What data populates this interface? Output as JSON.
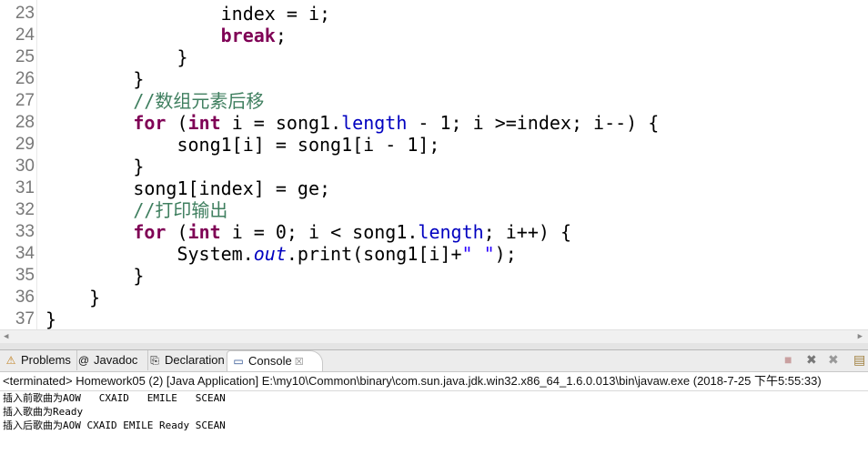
{
  "editor": {
    "lines": [
      {
        "n": "23",
        "indent": 16,
        "parts": [
          [
            "index = i;",
            ""
          ]
        ]
      },
      {
        "n": "24",
        "indent": 16,
        "parts": [
          [
            "break",
            "kw"
          ],
          [
            ";",
            ""
          ]
        ]
      },
      {
        "n": "25",
        "indent": 12,
        "parts": [
          [
            "}",
            ""
          ]
        ]
      },
      {
        "n": "26",
        "indent": 8,
        "parts": [
          [
            "}",
            ""
          ]
        ]
      },
      {
        "n": "27",
        "indent": 8,
        "parts": [
          [
            "//数组元素后移",
            "cm"
          ]
        ]
      },
      {
        "n": "28",
        "indent": 8,
        "parts": [
          [
            "for",
            "kw"
          ],
          [
            " (",
            ""
          ],
          [
            "int",
            "kw"
          ],
          [
            " i = song1.",
            ""
          ],
          [
            "length",
            "fld"
          ],
          [
            " - 1; i >=index; i--) {",
            ""
          ]
        ]
      },
      {
        "n": "29",
        "indent": 12,
        "parts": [
          [
            "song1[i] = song1[i - 1];",
            ""
          ]
        ]
      },
      {
        "n": "30",
        "indent": 8,
        "parts": [
          [
            "}",
            ""
          ]
        ]
      },
      {
        "n": "31",
        "indent": 8,
        "parts": [
          [
            "song1[index] = ge;",
            ""
          ]
        ]
      },
      {
        "n": "32",
        "indent": 8,
        "parts": [
          [
            "//打印输出",
            "cm"
          ]
        ]
      },
      {
        "n": "33",
        "indent": 8,
        "parts": [
          [
            "for",
            "kw"
          ],
          [
            " (",
            ""
          ],
          [
            "int",
            "kw"
          ],
          [
            " i = 0; i < song1.",
            ""
          ],
          [
            "length",
            "fld"
          ],
          [
            "; i++) {",
            ""
          ]
        ]
      },
      {
        "n": "34",
        "indent": 12,
        "parts": [
          [
            "System.",
            ""
          ],
          [
            "out",
            "st"
          ],
          [
            ".print(song1[i]+",
            ""
          ],
          [
            "\" \"",
            "str"
          ],
          [
            ");",
            ""
          ]
        ]
      },
      {
        "n": "35",
        "indent": 8,
        "parts": [
          [
            "}",
            ""
          ]
        ]
      },
      {
        "n": "36",
        "indent": 4,
        "parts": [
          [
            "}",
            ""
          ]
        ]
      },
      {
        "n": "37",
        "indent": 0,
        "parts": [
          [
            "}",
            ""
          ]
        ]
      }
    ]
  },
  "tabs": [
    {
      "label": "Problems",
      "icon": "problems-icon"
    },
    {
      "label": "Javadoc",
      "icon": "javadoc-icon"
    },
    {
      "label": "Declaration",
      "icon": "declaration-icon"
    },
    {
      "label": "Console",
      "icon": "console-icon",
      "active": true
    }
  ],
  "console": {
    "status": "<terminated> Homework05 (2) [Java Application] E:\\my10\\Common\\binary\\com.sun.java.jdk.win32.x86_64_1.6.0.013\\bin\\javaw.exe (2018-7-25 下午5:55:33)",
    "output": [
      "插入前歌曲为AOW   CXAID   EMILE   SCEAN",
      "插入歌曲为Ready",
      "插入后歌曲为AOW CXAID EMILE Ready SCEAN"
    ]
  }
}
